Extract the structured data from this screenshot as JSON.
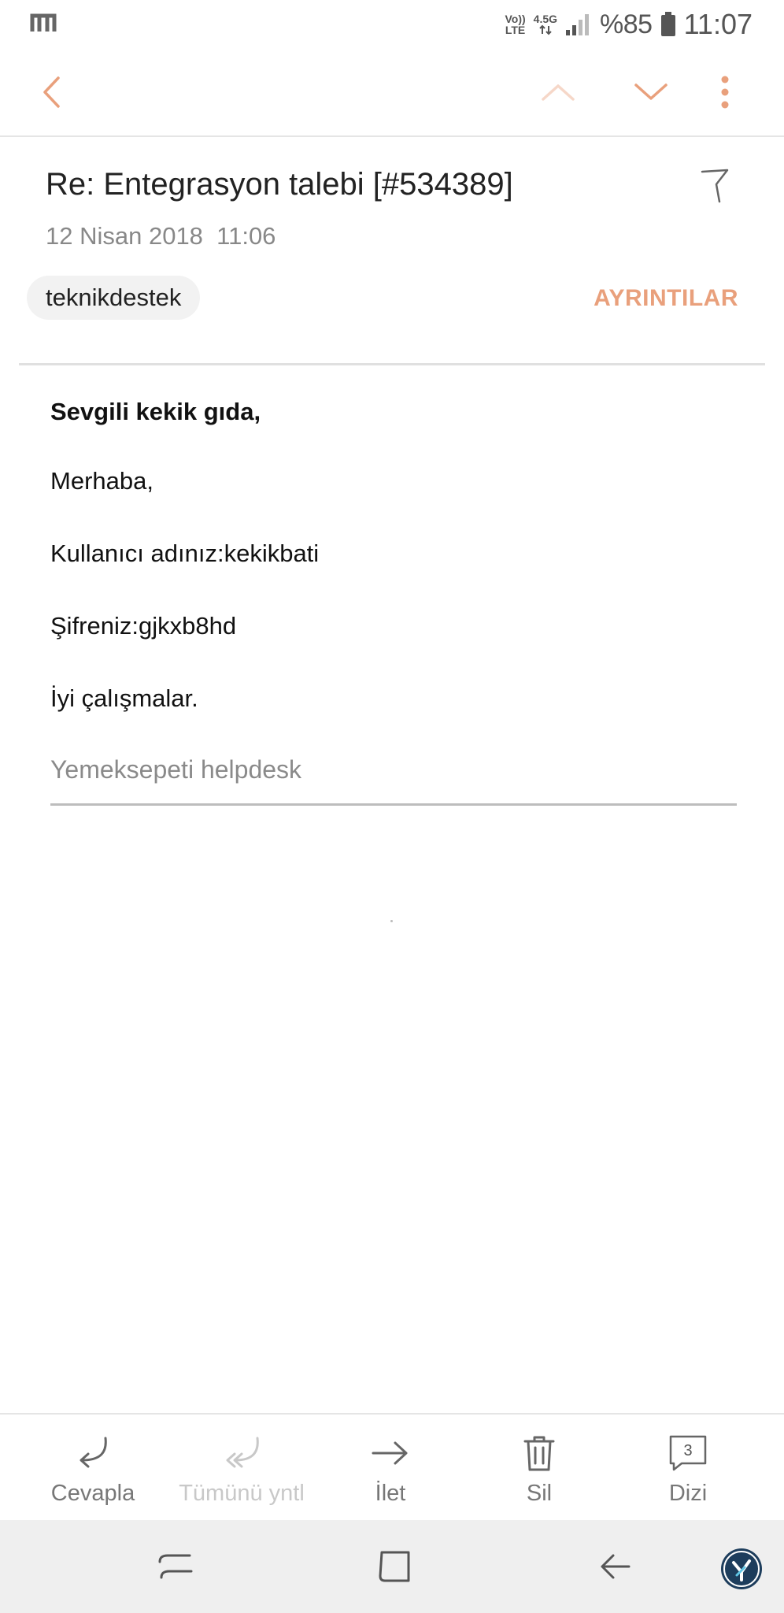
{
  "status_bar": {
    "volte_label_top": "Vo))",
    "volte_label_bottom": "LTE",
    "network_label": "4.5G",
    "battery_percent": "%85",
    "time": "11:07"
  },
  "toolbar": {
    "back_icon": "chevron-left-icon",
    "prev_icon": "chevron-up-icon",
    "next_icon": "chevron-down-icon",
    "more_icon": "more-vertical-icon",
    "accent_color": "#e9a07c"
  },
  "email": {
    "subject": "Re: Entegrasyon talebi [#534389]",
    "date": "12 Nisan 2018  11:06",
    "sender": "teknikdestek",
    "details_label": "AYRINTILAR",
    "greeting": "Sevgili kekik gıda,",
    "lines": [
      "Merhaba,",
      "Kullanıcı adınız:kekikbati",
      "Şifreniz:gjkxb8hd",
      "İyi çalışmalar."
    ],
    "signature": "Yemeksepeti helpdesk"
  },
  "actions": {
    "reply": "Cevapla",
    "reply_all": "Tümünü yntl",
    "forward": "İlet",
    "delete": "Sil",
    "thread": "Dizi",
    "thread_count": "3"
  }
}
